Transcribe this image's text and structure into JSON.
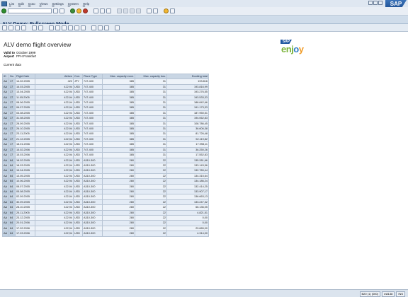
{
  "menu": {
    "items": [
      "List",
      "Edit",
      "Goto",
      "Views",
      "Settings",
      "System",
      "Help"
    ],
    "logo": "SAP"
  },
  "title": "ALV Demo: Fullscreen Mode",
  "report": {
    "heading": "ALV demo flight overview",
    "valid_to_label": "Valid to",
    "valid_to_value": "October 1999",
    "airport_label": "Airport",
    "airport_value": "FFH Frankfurt",
    "current_data": "Current data",
    "logo_sap": "SAP",
    "logo_enjoy": "enjoy"
  },
  "table": {
    "columns": [
      "ID",
      "No.",
      "Flight Date",
      "Airfare",
      "Curr.",
      "Plane Type",
      "Max. capacity econ.",
      "Max. capacity bus.",
      "Booking total"
    ],
    "rows": [
      [
        "AA",
        "17",
        "14.02.2005",
        "422",
        "JPY",
        "747-400",
        "385",
        "31",
        "193.816"
      ],
      [
        "AA",
        "17",
        "16.03.2005",
        "422,94",
        "USD",
        "747-400",
        "385",
        "31",
        "193.816,99"
      ],
      [
        "AA",
        "17",
        "13.04.2005",
        "422,94",
        "USD",
        "747-400",
        "385",
        "31",
        "193.276,55"
      ],
      [
        "AA",
        "17",
        "11.05.2005",
        "422,94",
        "USD",
        "747-400",
        "385",
        "31",
        "193.533,33"
      ],
      [
        "AA",
        "17",
        "08.06.2005",
        "422,94",
        "USD",
        "747-400",
        "385",
        "31",
        "188.842,66"
      ],
      [
        "AA",
        "17",
        "06.07.2005",
        "422,94",
        "USD",
        "747-400",
        "385",
        "31",
        "191.173,33"
      ],
      [
        "AA",
        "17",
        "03.08.2005",
        "422,94",
        "USD",
        "747-400",
        "385",
        "31",
        "187.950,51"
      ],
      [
        "AA",
        "17",
        "31.08.2005",
        "422,94",
        "USD",
        "747-400",
        "385",
        "31",
        "194.062,83"
      ],
      [
        "AA",
        "17",
        "28.09.2005",
        "422,94",
        "USD",
        "747-400",
        "385",
        "31",
        "108.786,45"
      ],
      [
        "AA",
        "17",
        "26.10.2005",
        "422,94",
        "USD",
        "747-400",
        "385",
        "31",
        "36.606,38"
      ],
      [
        "AA",
        "17",
        "23.11.2005",
        "422,94",
        "USD",
        "747-400",
        "385",
        "31",
        "81.726,48"
      ],
      [
        "AA",
        "17",
        "21.12.2005",
        "422,94",
        "USD",
        "747-400",
        "385",
        "31",
        "52.119,82"
      ],
      [
        "AA",
        "17",
        "18.01.2006",
        "422,94",
        "USD",
        "747-400",
        "385",
        "31",
        "17.998,11"
      ],
      [
        "AA",
        "17",
        "15.02.2006",
        "422,94",
        "USD",
        "747-400",
        "385",
        "31",
        "36.250,26"
      ],
      [
        "AA",
        "17",
        "15.03.2006",
        "422,94",
        "USD",
        "747-400",
        "385",
        "31",
        "17.552,83"
      ],
      [
        "AA",
        "64",
        "18.02.2005",
        "422,94",
        "USD",
        "A310-300",
        "280",
        "22",
        "135.281,66"
      ],
      [
        "AA",
        "64",
        "18.03.2005",
        "422,94",
        "USD",
        "A310-300",
        "280",
        "22",
        "133.143,56"
      ],
      [
        "AA",
        "64",
        "15.04.2005",
        "422,94",
        "USD",
        "A310-300",
        "280",
        "22",
        "132.789,44"
      ],
      [
        "AA",
        "64",
        "13.05.2005",
        "422,94",
        "USD",
        "A310-300",
        "280",
        "22",
        "134.315,64"
      ],
      [
        "AA",
        "64",
        "10.06.2005",
        "422,94",
        "USD",
        "A310-300",
        "280",
        "22",
        "134.186,24"
      ],
      [
        "AA",
        "64",
        "08.07.2005",
        "422,94",
        "USD",
        "A310-300",
        "280",
        "22",
        "132.414,25"
      ],
      [
        "AA",
        "64",
        "05.08.2005",
        "422,94",
        "USD",
        "A310-300",
        "280",
        "22",
        "133.907,17"
      ],
      [
        "AA",
        "64",
        "02.09.2005",
        "422,94",
        "USD",
        "A310-300",
        "280",
        "22",
        "136.663,13"
      ],
      [
        "AA",
        "64",
        "30.09.2005",
        "422,94",
        "USD",
        "A310-300",
        "280",
        "22",
        "133.247,32"
      ],
      [
        "AA",
        "64",
        "28.10.2005",
        "422,94",
        "USD",
        "A310-300",
        "280",
        "22",
        "66.136,05"
      ],
      [
        "AA",
        "64",
        "25.11.2005",
        "422,94",
        "USD",
        "A310-300",
        "280",
        "22",
        "4.821,51"
      ],
      [
        "AA",
        "64",
        "23.12.2005",
        "422,94",
        "USD",
        "A310-300",
        "280",
        "22",
        "0,00"
      ],
      [
        "AA",
        "64",
        "20.01.2006",
        "422,94",
        "USD",
        "A310-300",
        "280",
        "22",
        "0,00"
      ],
      [
        "AA",
        "64",
        "17.02.2006",
        "422,94",
        "USD",
        "A310-300",
        "280",
        "22",
        "29.665,00"
      ],
      [
        "AA",
        "64",
        "17.03.2006",
        "422,94",
        "USD",
        "A310-300",
        "280",
        "22",
        "4.314,00"
      ]
    ]
  },
  "status": {
    "system": "B20 (1) (000)",
    "server": "m8138",
    "mode": "INS"
  }
}
